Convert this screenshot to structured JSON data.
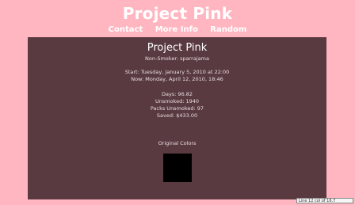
{
  "header": {
    "title": "Project Pink",
    "nav": [
      {
        "label": "Contact"
      },
      {
        "label": "More Info"
      },
      {
        "label": "Random"
      }
    ]
  },
  "panel": {
    "title": "Project Pink",
    "non_smoker": "Non-Smoker: sparrajama",
    "start": "Start: Tuesday, January 5, 2010 at 22:00",
    "now": "Now: Monday, April 12, 2010, 18:46",
    "stats": {
      "days": "Days: 96.82",
      "unsmoked": "Unsmoked: 1940",
      "packs_unsmoked": "Packs Unsmoked: 97",
      "saved": "Saved: $433.00"
    },
    "original_colors_label": "Original Colors",
    "swatch_color": "#000000"
  },
  "status_bar": {
    "text": "Line 12 col of 16.7"
  }
}
